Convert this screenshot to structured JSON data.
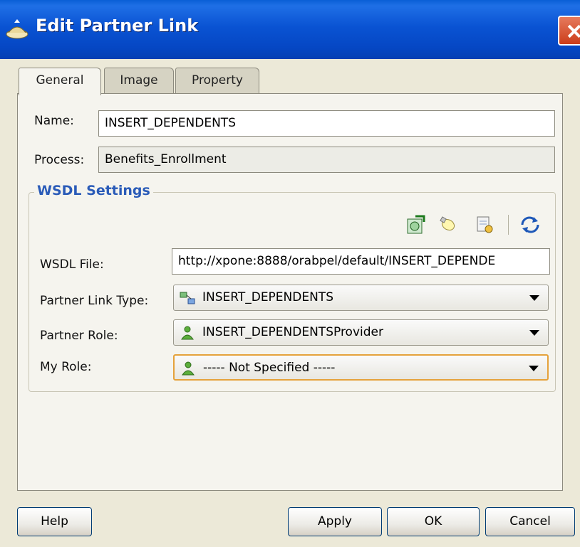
{
  "window": {
    "title": "Edit Partner Link"
  },
  "tabs": [
    {
      "label": "General",
      "active": true
    },
    {
      "label": "Image",
      "active": false
    },
    {
      "label": "Property",
      "active": false
    }
  ],
  "form": {
    "name_label": "Name:",
    "name_value": "INSERT_DEPENDENTS",
    "process_label": "Process:",
    "process_value": "Benefits_Enrollment"
  },
  "wsdl": {
    "group_label": "WSDL Settings",
    "toolbar_icons": [
      "service-explorer-icon",
      "lightbulb-icon",
      "browse-wsdl-icon",
      "refresh-icon"
    ],
    "wsdl_file_label": "WSDL File:",
    "wsdl_file_value": "http://xpone:8888/orabpel/default/INSERT_DEPENDE",
    "partner_link_type_label": "Partner Link Type:",
    "partner_link_type_value": "INSERT_DEPENDENTS",
    "partner_role_label": "Partner Role:",
    "partner_role_value": "INSERT_DEPENDENTSProvider",
    "my_role_label": "My Role:",
    "my_role_value": "----- Not Specified -----"
  },
  "buttons": {
    "help": "Help",
    "apply": "Apply",
    "ok": "OK",
    "cancel": "Cancel"
  },
  "colors": {
    "titlebar": "#0a53d3",
    "legend": "#2a5bb8",
    "focus": "#e5a23b"
  }
}
